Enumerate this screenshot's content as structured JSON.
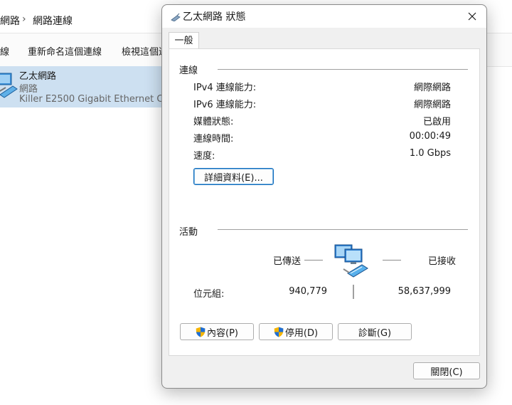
{
  "explorer": {
    "breadcrumb_1": "網路",
    "breadcrumb_sep": "›",
    "breadcrumb_2": "網路連線",
    "toolbar_0": "線",
    "toolbar_1": "重新命名這個連線",
    "toolbar_2": "檢視這個連",
    "item_name": "乙太網路",
    "item_type": "網路",
    "item_device": "Killer E2500 Gigabit Ethernet C..."
  },
  "dialog": {
    "title": "乙太網路 狀態",
    "tab_general": "一般",
    "connection": {
      "heading": "連線",
      "rows": [
        {
          "label": "IPv4 連線能力:",
          "value": "網際網路"
        },
        {
          "label": "IPv6 連線能力:",
          "value": "網際網路"
        },
        {
          "label": "媒體狀態:",
          "value": "已啟用"
        },
        {
          "label": "連線時間:",
          "value": "00:00:49"
        },
        {
          "label": "速度:",
          "value": "1.0 Gbps"
        }
      ],
      "details_button": "詳細資料(E)..."
    },
    "activity": {
      "heading": "活動",
      "sent_label": "已傳送",
      "received_label": "已接收",
      "bytes_label": "位元組:",
      "bytes_sent": "940,779",
      "bytes_received": "58,637,999"
    },
    "buttons": {
      "properties": "內容(P)",
      "disable": "停用(D)",
      "diagnose": "診斷(G)",
      "close": "關閉(C)"
    }
  },
  "icons": {
    "title": "network-cable-icon",
    "close": "close-icon",
    "shield": "uac-shield-icon",
    "network": "network-computers-icon"
  }
}
